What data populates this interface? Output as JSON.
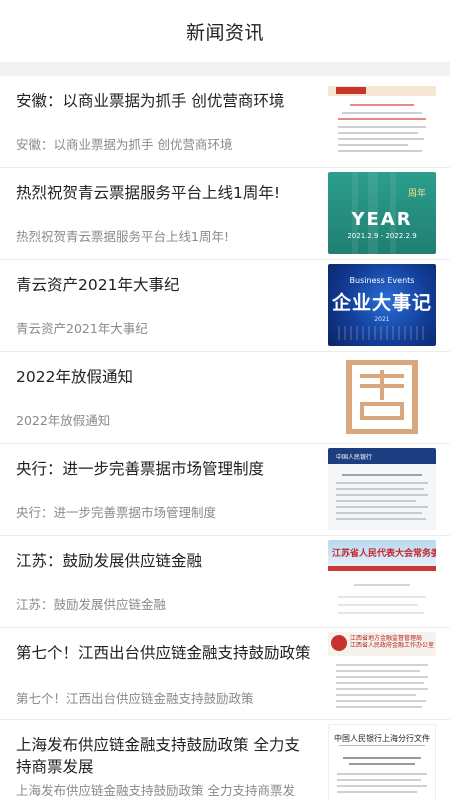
{
  "header": {
    "title": "新闻资讯"
  },
  "thumbs": {
    "year_text": "YEAR",
    "year_date": "2021.2.9 - 2022.2.9",
    "biz_en": "Business Events",
    "biz_cn": "企业大事记",
    "biz_year": "2021",
    "bank_name": "中国人民银行",
    "js_name": "江苏省人民代表大会常务委员会",
    "pboc_head": "中国人民银行上海分行文件"
  },
  "news": [
    {
      "title": "安徽：以商业票据为抓手 创优营商环境",
      "subtitle": "安徽：以商业票据为抓手 创优营商环境",
      "thumb_icon": "government-document-icon"
    },
    {
      "title": "热烈祝贺青云票据服务平台上线1周年!",
      "subtitle": "热烈祝贺青云票据服务平台上线1周年!",
      "thumb_icon": "anniversary-poster-icon"
    },
    {
      "title": "青云资产2021年大事纪",
      "subtitle": "青云资产2021年大事纪",
      "thumb_icon": "business-events-poster-icon"
    },
    {
      "title": "2022年放假通知",
      "subtitle": "2022年放假通知",
      "thumb_icon": "holiday-notice-icon"
    },
    {
      "title": "央行：进一步完善票据市场管理制度",
      "subtitle": "央行：进一步完善票据市场管理制度",
      "thumb_icon": "central-bank-document-icon"
    },
    {
      "title": "江苏：鼓励发展供应链金融",
      "subtitle": "江苏：鼓励发展供应链金融",
      "thumb_icon": "jiangsu-document-icon"
    },
    {
      "title": "第七个！江西出台供应链金融支持鼓励政策",
      "subtitle": "第七个！江西出台供应链金融支持鼓励政策",
      "thumb_icon": "jiangxi-document-icon"
    },
    {
      "title": "上海发布供应链金融支持鼓励政策 全力支持商票发展",
      "subtitle": "上海发布供应链金融支持鼓励政策 全力支持商票发",
      "thumb_icon": "shanghai-document-icon"
    }
  ]
}
